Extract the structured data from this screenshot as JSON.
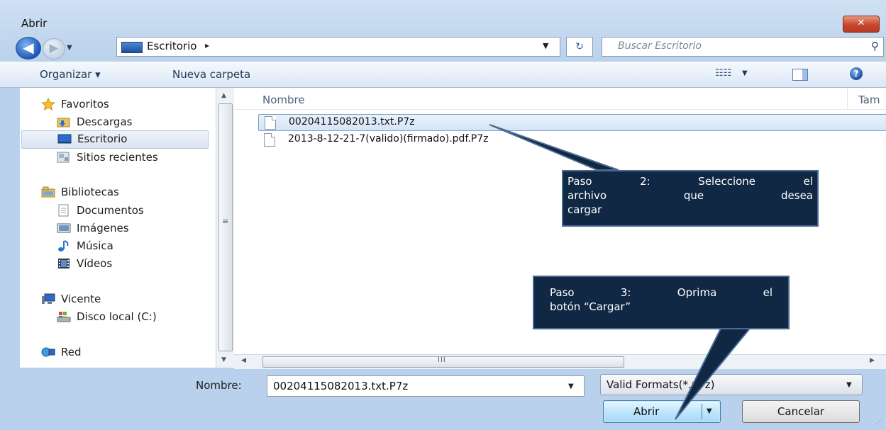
{
  "window": {
    "title": "Abrir",
    "close_label": "✕"
  },
  "navbar": {
    "back_glyph": "◀",
    "forward_glyph": "▶",
    "history_glyph": "▼",
    "address": {
      "location": "Escritorio",
      "separator": "▸",
      "dropdown_glyph": "▼"
    },
    "refresh_glyph": "↻",
    "search": {
      "placeholder": "Buscar Escritorio",
      "icon": "search-icon"
    }
  },
  "toolbar": {
    "organize_label": "Organizar ▾",
    "new_folder_label": "Nueva carpeta",
    "view_glyph": "☷☷",
    "view_drop": "▼",
    "help_glyph": "?"
  },
  "sidebar": {
    "groups": [
      {
        "label": "Favoritos",
        "icon": "star-icon"
      },
      {
        "label": "Bibliotecas",
        "icon": "libraries-icon"
      },
      {
        "label": "Vicente",
        "icon": "computer-icon"
      },
      {
        "label": "Red",
        "icon": "network-icon"
      }
    ],
    "items": [
      {
        "label": "Descargas",
        "icon": "downloads-folder-icon"
      },
      {
        "label": "Escritorio",
        "icon": "desktop-icon",
        "selected": true
      },
      {
        "label": "Sitios recientes",
        "icon": "recent-places-icon"
      },
      {
        "label": "Documentos",
        "icon": "documents-icon"
      },
      {
        "label": "Imágenes",
        "icon": "pictures-icon"
      },
      {
        "label": "Música",
        "icon": "music-icon"
      },
      {
        "label": "Vídeos",
        "icon": "videos-icon"
      },
      {
        "label": "Disco local (C:)",
        "icon": "local-disk-icon"
      }
    ]
  },
  "filelist": {
    "columns": [
      "Nombre",
      "Tam"
    ],
    "files": [
      {
        "name": "00204115082013.txt.P7z",
        "selected": true
      },
      {
        "name": "2013-8-12-21-7(valido)(firmado).pdf.P7z",
        "selected": false
      }
    ],
    "hscroll_grip": "III"
  },
  "bottom": {
    "filename_label": "Nombre:",
    "filename_value": "00204115082013.txt.P7z",
    "filter_value": "Valid Formats(*.p7z)",
    "open_label": "Abrir",
    "cancel_label": "Cancelar"
  },
  "annotations": {
    "step2_lines": [
      "Paso 2: Seleccione el",
      "archivo que desea",
      "cargar"
    ],
    "step3_lines": [
      "Paso 3: Oprima el",
      "botón “Cargar”"
    ]
  },
  "colors": {
    "callout_fill": "#112844",
    "callout_border": "#4a6a92",
    "selection_border": "#7da2ce",
    "close_red": "#c8462c"
  }
}
